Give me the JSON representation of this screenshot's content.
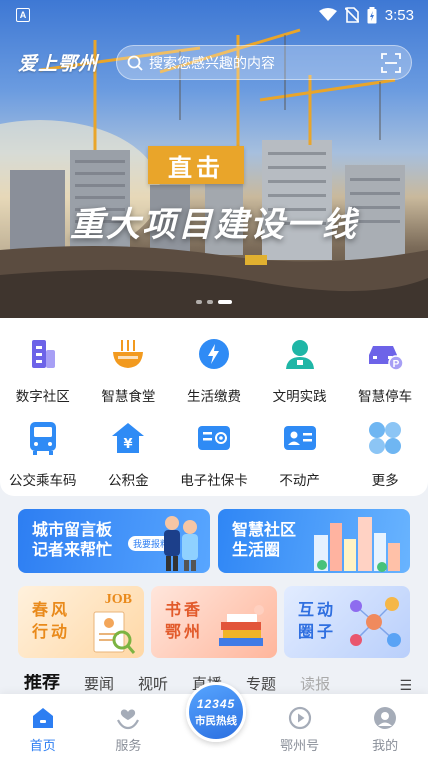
{
  "status_bar": {
    "time": "3:53",
    "left_icon": "A"
  },
  "header": {
    "logo_text": "爱上鄂州",
    "search_placeholder": "搜索您感兴趣的内容"
  },
  "banner": {
    "tag": "直击",
    "title": "重大项目建设一线",
    "slide_count": 3,
    "active_slide": 3
  },
  "services": {
    "row1": [
      {
        "label": "数字社区",
        "icon": "building-icon",
        "color": "#6d63e8"
      },
      {
        "label": "智慧食堂",
        "icon": "bowl-icon",
        "color": "#f29a1f"
      },
      {
        "label": "生活缴费",
        "icon": "water-drop-icon",
        "color": "#2f8bf5"
      },
      {
        "label": "文明实践",
        "icon": "person-icon",
        "color": "#1fb6a6"
      },
      {
        "label": "智慧停车",
        "icon": "car-icon",
        "color": "#6d63e8"
      }
    ],
    "row2": [
      {
        "label": "公交乘车码",
        "icon": "bus-icon",
        "color": "#2f8bf5"
      },
      {
        "label": "公积金",
        "icon": "house-yuan-icon",
        "color": "#2f8bf5"
      },
      {
        "label": "电子社保卡",
        "icon": "card-icon",
        "color": "#2f8bf5"
      },
      {
        "label": "不动产",
        "icon": "id-card-icon",
        "color": "#2f8bf5"
      },
      {
        "label": "更多",
        "icon": "grid-icon",
        "color": "#6fb6f2"
      }
    ]
  },
  "promos": [
    {
      "line1": "城市留言板",
      "line2": "记者来帮忙",
      "badge": "我要报料"
    },
    {
      "line1": "智慧社区",
      "line2": "生活圈"
    }
  ],
  "tiles": [
    {
      "line1": "春风",
      "line2": "行动",
      "badge": "JOB"
    },
    {
      "line1": "书香",
      "line2": "鄂州"
    },
    {
      "line1": "互动",
      "line2": "圈子"
    }
  ],
  "tabs": [
    {
      "label": "推荐",
      "active": true
    },
    {
      "label": "要闻",
      "active": false
    },
    {
      "label": "视听",
      "active": false
    },
    {
      "label": "直播",
      "active": false
    },
    {
      "label": "专题",
      "active": false
    },
    {
      "label": "读报",
      "active": false
    }
  ],
  "hotline": {
    "number": "12345",
    "label": "市民热线"
  },
  "bottom_nav": [
    {
      "label": "首页",
      "active": true
    },
    {
      "label": "服务",
      "active": false
    },
    {
      "label": "",
      "active": false
    },
    {
      "label": "鄂州号",
      "active": false
    },
    {
      "label": "我的",
      "active": false
    }
  ]
}
